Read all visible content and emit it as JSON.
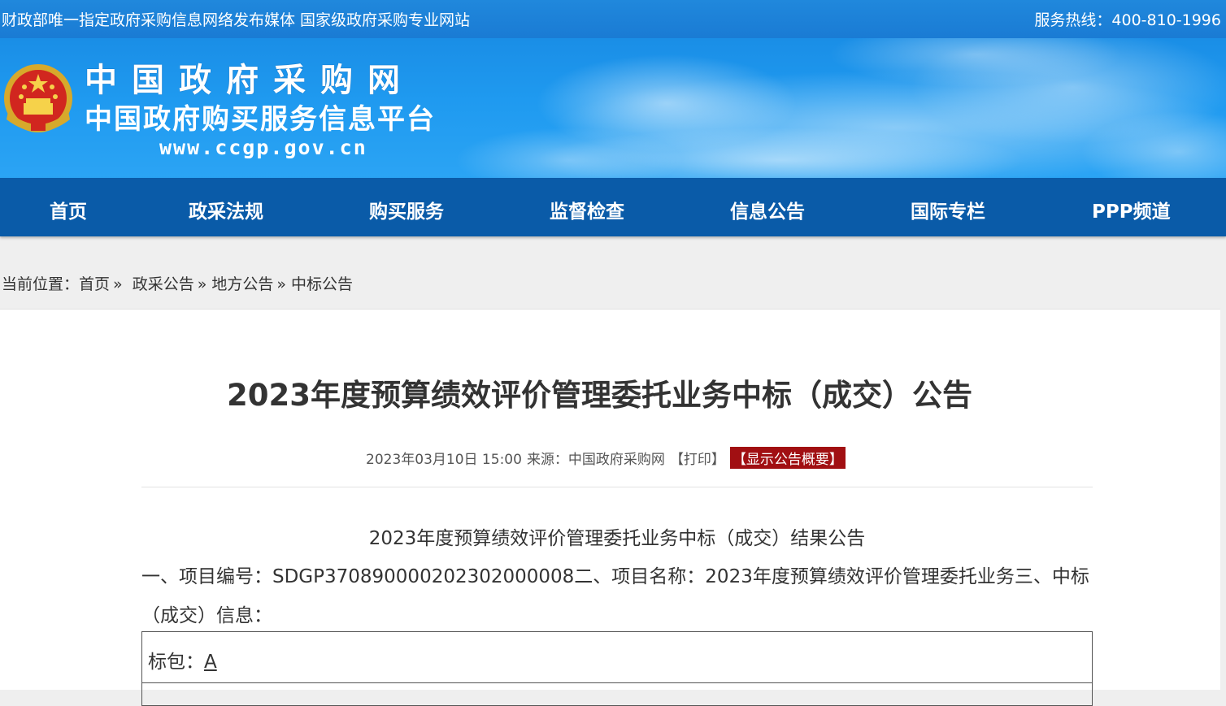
{
  "topbar": {
    "slogan": "财政部唯一指定政府采购信息网络发布媒体 国家级政府采购专业网站",
    "hotline": "服务热线：400-810-1996"
  },
  "banner": {
    "logo_title": "中国政府采购网",
    "logo_subtitle": "中国政府购买服务信息平台",
    "logo_url": "www.ccgp.gov.cn"
  },
  "nav": {
    "items": [
      {
        "label": "首页"
      },
      {
        "label": "政采法规"
      },
      {
        "label": "购买服务"
      },
      {
        "label": "监督检查"
      },
      {
        "label": "信息公告"
      },
      {
        "label": "国际专栏"
      },
      {
        "label": "PPP频道"
      }
    ]
  },
  "breadcrumb": {
    "prefix": "当前位置：",
    "items": [
      "首页",
      "政采公告",
      "地方公告",
      "中标公告"
    ],
    "separator": "»"
  },
  "article": {
    "title": "2023年度预算绩效评价管理委托业务中标（成交）公告",
    "datetime": "2023年03月10日 15:00",
    "source": "来源：中国政府采购网",
    "print_label": "【打印】",
    "summary_label": "【显示公告概要】",
    "subtitle": "2023年度预算绩效评价管理委托业务中标（成交）结果公告",
    "paragraph": "一、项目编号：SDGP370890000202302000008二、项目名称：2023年度预算绩效评价管理委托业务三、中标（成交）信息：",
    "package_label": "标包：",
    "package_value": "A"
  },
  "colors": {
    "topbar": "#1c7ed6",
    "banner": "#1f9af0",
    "nav": "#0a5ba8",
    "summary_button": "#a10f12"
  }
}
